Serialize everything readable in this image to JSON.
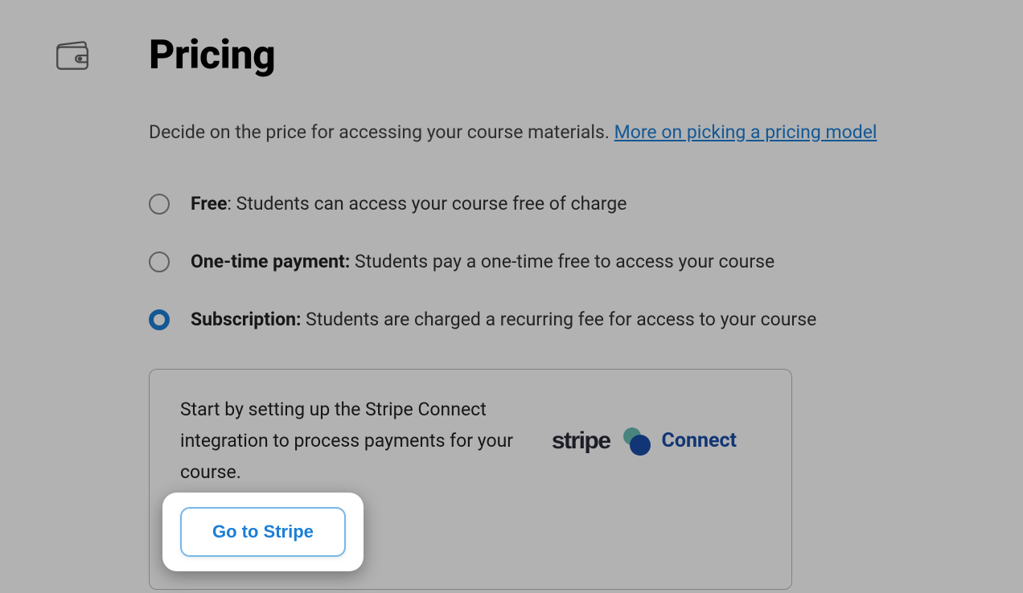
{
  "header": {
    "title": "Pricing"
  },
  "description": {
    "text": "Decide on the price for accessing your course materials. ",
    "link_text": "More on picking a pricing model"
  },
  "options": [
    {
      "label": "Free",
      "suffix": ": Students can access your course free of charge",
      "selected": false
    },
    {
      "label": "One-time payment:",
      "suffix": " Students pay a one-time free to access your course",
      "selected": false
    },
    {
      "label": "Subscription:",
      "suffix": " Students are charged a recurring fee for access to your course",
      "selected": true
    }
  ],
  "panel": {
    "text": "Start by setting up the Stripe Connect integration to process payments for your course.",
    "stripe_word": "stripe",
    "connect_word": "Connect",
    "cta_label": "Go to Stripe"
  }
}
